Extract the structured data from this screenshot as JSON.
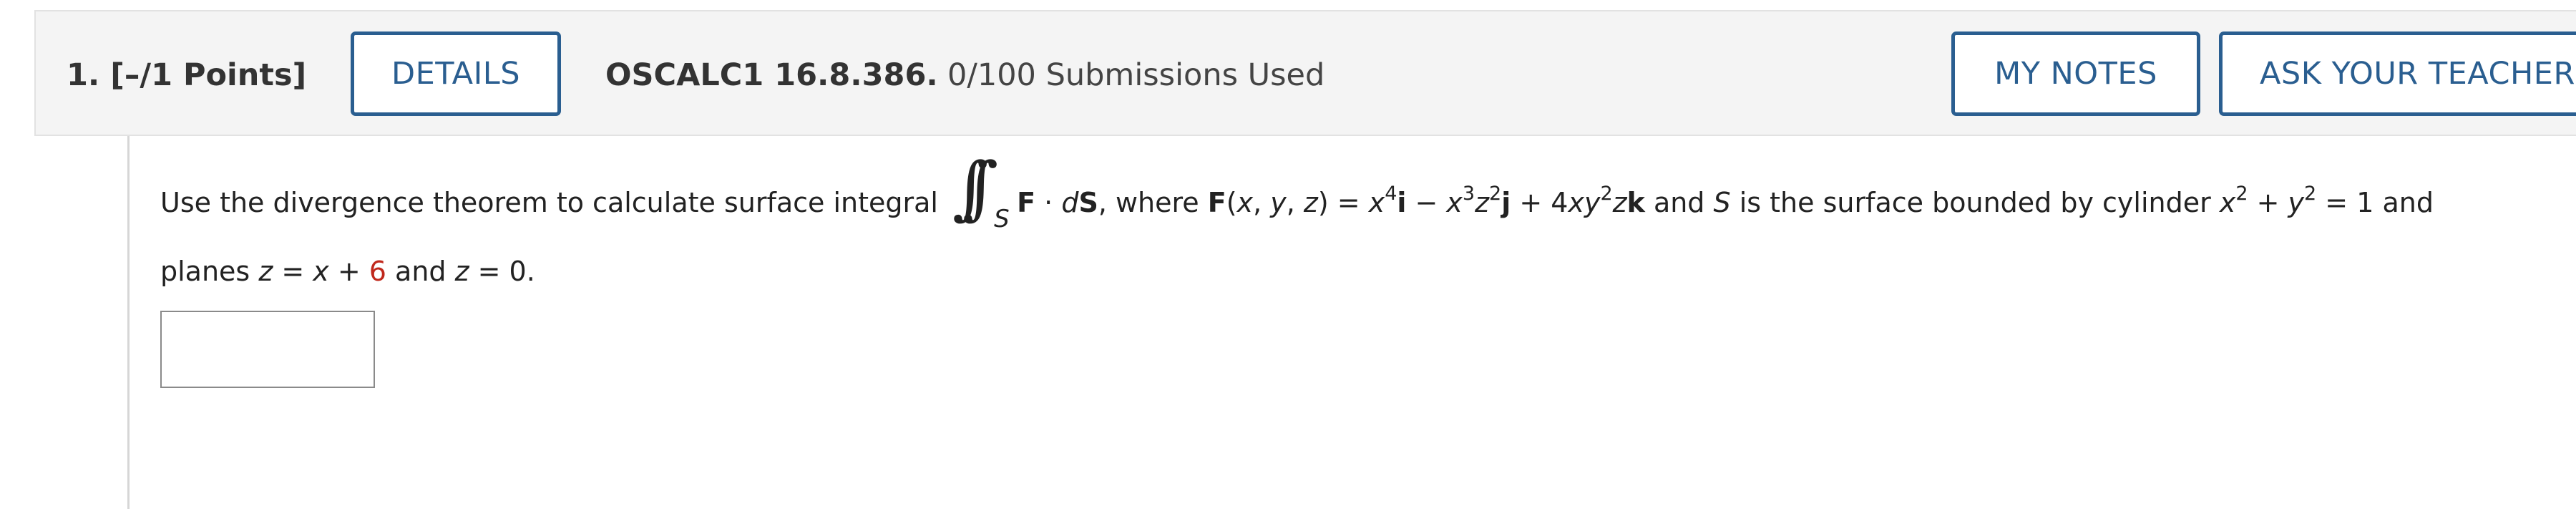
{
  "question": {
    "number_label": "1.",
    "points_label": "[–/1 Points]",
    "details_label": "DETAILS",
    "code": "OSCALC1 16.8.386.",
    "submissions": "0/100 Submissions Used",
    "my_notes_label": "MY NOTES",
    "ask_teacher_label": "ASK YOUR TEACHER"
  },
  "problem": {
    "intro": "Use the divergence theorem to calculate surface integral",
    "integral_sub": "S",
    "F_bold": "F",
    "dot": " · ",
    "d_italic": "d",
    "S_bold": "S",
    "where_text": ", where ",
    "F_bold2": "F",
    "paren_open": "(",
    "var_x": "x",
    "comma1": ", ",
    "var_y": "y",
    "comma2": ", ",
    "var_z": "z",
    "paren_close_eq": ") = ",
    "t1_x": "x",
    "t1_exp": "4",
    "i_bold": "i",
    "minus": " − ",
    "t2_x": "x",
    "t2_exp1": "3",
    "t2_z": "z",
    "t2_exp2": "2",
    "j_bold": "j",
    "plus": " + 4",
    "t3_x": "xy",
    "t3_exp": "2",
    "t3_z": "z",
    "k_bold": "k",
    "and_text": " and ",
    "S_ital": "S",
    "surface_text": " is the surface bounded by cylinder ",
    "cyl_x": "x",
    "cyl_exp1": "2",
    "cyl_plus": " + ",
    "cyl_y": "y",
    "cyl_exp2": "2",
    "cyl_eq": " = 1 and",
    "line2_planes": "planes ",
    "p1_z": "z",
    "p1_eq": " = ",
    "p1_x": "x",
    "p1_plus": " + ",
    "p1_num": "6",
    "p2_and": " and ",
    "p2_z": "z",
    "p2_eq": " = 0."
  },
  "answer": {
    "value": ""
  },
  "colors": {
    "accent": "#2a5e90",
    "highlight_number": "#c0281c"
  }
}
